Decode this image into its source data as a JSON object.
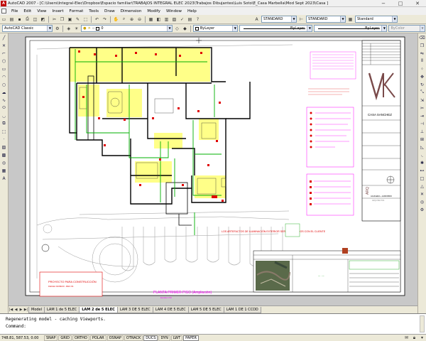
{
  "window": {
    "title": "AutoCAD 2007 - [C:\\Users\\Integral-Elec\\Dropbox\\Espacio familiar\\TRABAJOS INTEGRAL ELEC 2023\\Trabajos Dibujantes\\Luis Soto\\E_Casa Marbella\\Mod Sept 2023\\Casa ]",
    "min": "−",
    "max": "□",
    "close": "✕"
  },
  "menu": [
    "File",
    "Edit",
    "View",
    "Insert",
    "Format",
    "Tools",
    "Draw",
    "Dimension",
    "Modify",
    "Window",
    "Help"
  ],
  "toolbar2": {
    "workspace": "AutoCAD Classic",
    "layer": "0",
    "color": "ByLayer",
    "linetype": "ByLayer",
    "lineweight": "ByLayer",
    "plotstyle": "ByColor"
  },
  "toolbar1": {
    "textstyle": "STANDARD",
    "dimstyle": "STANDARD",
    "tablestyle": "Standard"
  },
  "drawing": {
    "plan_title": "PLANTA PRIMER PISO (Ampliación)",
    "plan_scale": "Escala 1:50",
    "stamp_line1": "PROYECTO PARA CONSTRUCCIÓN",
    "stamp_line2": "FECHA 01/09/23 - REV 01",
    "client": "CASA SANCHEZ",
    "note_red": "LOS ARTEFACTOS DE ILUMINACIÓN EXTERIOR SERÁN DEFINIDOS CON EL CLIENTE",
    "side_text": "ARQ",
    "firm": "AGUILERA + HUIDOBRO",
    "firm_sub": "ARQUITECTOS"
  },
  "tabs": {
    "nav": [
      "|◀",
      "◀",
      "▶",
      "▶|"
    ],
    "items": [
      "Model",
      "LAM 1 de 5 ELEC",
      "LAM 2 de 5 ELEC",
      "LAM 3 DE 5 ELEC",
      "LAM 4 DE 5 ELEC",
      "LAM 5 DE 5 ELEC",
      "LAM 1 DE 1 CCDD"
    ],
    "active": 2
  },
  "command": {
    "line1": "Regenerating model - caching Viewports.",
    "line2": "Command:"
  },
  "status": {
    "coords": "748.81, 587.53, 0.00",
    "toggles": [
      "SNAP",
      "GRID",
      "ORTHO",
      "POLAR",
      "OSNAP",
      "OTRACK",
      "DUCS",
      "DYN",
      "LWT",
      "PAPER"
    ],
    "on": [
      "DUCS",
      "PAPER"
    ]
  },
  "colors": {
    "wall": "#000000",
    "circuit": "#00b000",
    "power": "#e00000",
    "highlight": "#ffff66",
    "legend": "#ff00ff"
  }
}
